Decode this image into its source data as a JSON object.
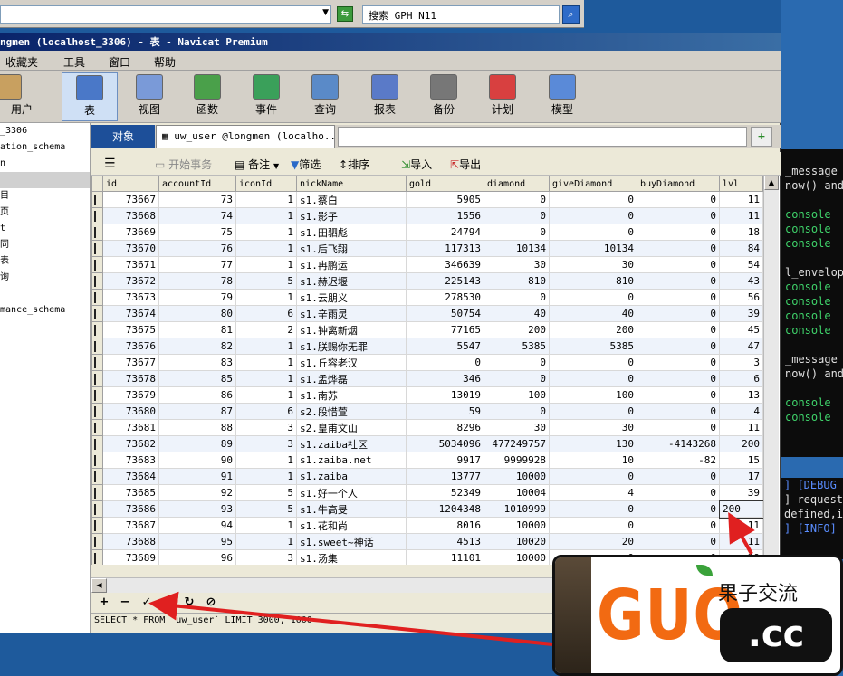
{
  "top": {
    "search_text": "搜索 GPH N11"
  },
  "window": {
    "title": "ngmen (localhost_3306) - 表 - Navicat Premium",
    "min": "_",
    "max": "□",
    "close": "×"
  },
  "menu": [
    "收藏夹",
    "工具",
    "窗口",
    "帮助"
  ],
  "toolbar": [
    {
      "label": "用户",
      "icon": "user-icon",
      "color": "#c8a060"
    },
    {
      "label": "表",
      "icon": "table-icon",
      "color": "#4a78c8"
    },
    {
      "label": "视图",
      "icon": "view-icon",
      "color": "#7a9ad8"
    },
    {
      "label": "函数",
      "icon": "function-icon",
      "color": "#4aa04a"
    },
    {
      "label": "事件",
      "icon": "event-icon",
      "color": "#3aa05a"
    },
    {
      "label": "查询",
      "icon": "query-icon",
      "color": "#5a8ac8"
    },
    {
      "label": "报表",
      "icon": "report-icon",
      "color": "#5a7ac8"
    },
    {
      "label": "备份",
      "icon": "backup-icon",
      "color": "#777777"
    },
    {
      "label": "计划",
      "icon": "schedule-icon",
      "color": "#d84040"
    },
    {
      "label": "模型",
      "icon": "model-icon",
      "color": "#5a8ad8"
    }
  ],
  "tree": [
    "_3306",
    "ation_schema",
    "n",
    "",
    "目",
    "页",
    "t",
    "同",
    "表",
    "询",
    "",
    "mance_schema"
  ],
  "tabs": {
    "objects": "对象",
    "table_tab": "uw_user @longmen (localho..."
  },
  "grid_toolbar": {
    "begin_tx": "开始事务",
    "memo": "备注",
    "filter": "筛选",
    "sort": "排序",
    "import": "导入",
    "export": "导出"
  },
  "columns": [
    "id",
    "accountId",
    "iconId",
    "nickName",
    "gold",
    "diamond",
    "giveDiamond",
    "buyDiamond",
    "lvl"
  ],
  "rows": [
    [
      "73667",
      "73",
      "1",
      "s1.蔡白",
      "5905",
      "0",
      "0",
      "0",
      "11"
    ],
    [
      "73668",
      "74",
      "1",
      "s1.影子",
      "1556",
      "0",
      "0",
      "0",
      "11"
    ],
    [
      "73669",
      "75",
      "1",
      "s1.田驷彪",
      "24794",
      "0",
      "0",
      "0",
      "18"
    ],
    [
      "73670",
      "76",
      "1",
      "s1.后飞翔",
      "117313",
      "10134",
      "10134",
      "0",
      "84"
    ],
    [
      "73671",
      "77",
      "1",
      "s1.冉鹏运",
      "346639",
      "30",
      "30",
      "0",
      "54"
    ],
    [
      "73672",
      "78",
      "5",
      "s1.赫迟堰",
      "225143",
      "810",
      "810",
      "0",
      "43"
    ],
    [
      "73673",
      "79",
      "1",
      "s1.云朋义",
      "278530",
      "0",
      "0",
      "0",
      "56"
    ],
    [
      "73674",
      "80",
      "6",
      "s1.辛雨灵",
      "50754",
      "40",
      "40",
      "0",
      "39"
    ],
    [
      "73675",
      "81",
      "2",
      "s1.钟离新烟",
      "77165",
      "200",
      "200",
      "0",
      "45"
    ],
    [
      "73676",
      "82",
      "1",
      "s1.朕赐你无罪",
      "5547",
      "5385",
      "5385",
      "0",
      "47"
    ],
    [
      "73677",
      "83",
      "1",
      "s1.丘容老汉",
      "0",
      "0",
      "0",
      "0",
      "3"
    ],
    [
      "73678",
      "85",
      "1",
      "s1.孟烨磊",
      "346",
      "0",
      "0",
      "0",
      "6"
    ],
    [
      "73679",
      "86",
      "1",
      "s1.南苏",
      "13019",
      "100",
      "100",
      "0",
      "13"
    ],
    [
      "73680",
      "87",
      "6",
      "s2.段惜萱",
      "59",
      "0",
      "0",
      "0",
      "4"
    ],
    [
      "73681",
      "88",
      "3",
      "s2.皇甫文山",
      "8296",
      "30",
      "30",
      "0",
      "11"
    ],
    [
      "73682",
      "89",
      "3",
      "s1.zaiba社区",
      "5034096",
      "477249757",
      "130",
      "-4143268",
      "200"
    ],
    [
      "73683",
      "90",
      "1",
      "s1.zaiba.net",
      "9917",
      "9999928",
      "10",
      "-82",
      "15"
    ],
    [
      "73684",
      "91",
      "1",
      "s1.zaiba",
      "13777",
      "10000",
      "0",
      "0",
      "17"
    ],
    [
      "73685",
      "92",
      "5",
      "s1.好一个人",
      "52349",
      "10004",
      "4",
      "0",
      "39"
    ],
    [
      "73686",
      "93",
      "5",
      "s1.牛高旻",
      "1204348",
      "1010999",
      "0",
      "0",
      "200"
    ],
    [
      "73687",
      "94",
      "1",
      "s1.花和尚",
      "8016",
      "10000",
      "0",
      "0",
      "11"
    ],
    [
      "73688",
      "95",
      "1",
      "s1.sweet~神话",
      "4513",
      "10020",
      "20",
      "0",
      "11"
    ],
    [
      "73689",
      "96",
      "3",
      "s1.汤集",
      "11101",
      "10000",
      "0",
      "0",
      "39"
    ]
  ],
  "nav": [
    "+",
    "−",
    "✓",
    "×",
    "↻",
    "⊘"
  ],
  "sql": "SELECT * FROM `uw_user` LIMIT 3000, 1000",
  "console_top": [
    "",
    "_message",
    "now() and",
    "",
    "console",
    "console",
    "console",
    "",
    "l_envelop",
    "console",
    "console",
    "console",
    "console",
    "",
    "_message",
    "now() and",
    "",
    "console",
    "console"
  ],
  "console_bottom": [
    "] [DEBUG",
    "] request",
    "defined,i",
    "] [INFO]"
  ],
  "watermark": {
    "logo": "GUO",
    "cn": "果子交流",
    "cc": ".cc"
  }
}
